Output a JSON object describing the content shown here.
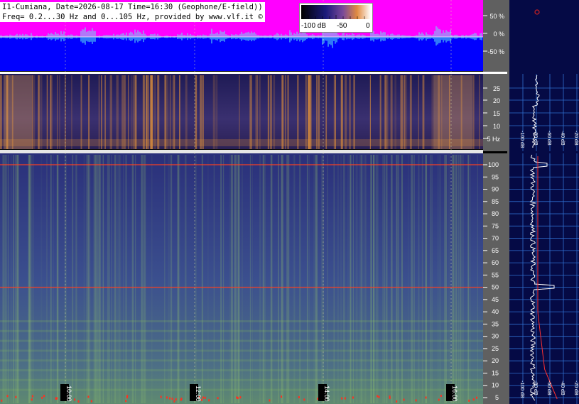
{
  "header": {
    "line1": "I1-Cumiana, Date=2026-08-17 Time=16:30 (Geophone/E-field))",
    "line2": "Freq= 0.2...30 Hz and 0...105 Hz, provided by www.vlf.it ©"
  },
  "colorbar": {
    "label_min": "-100 dB",
    "label_mid": "-50",
    "label_max": "0"
  },
  "time_labels": [
    "10:00",
    "12:00",
    "14:00",
    "16:00"
  ],
  "colors": {
    "magenta": "#ff00ff",
    "blue": "#0000ff",
    "panel_bg": "#050a45",
    "grid_cyan": "#3aa0ff",
    "hum_red": "#ff2020"
  },
  "chart_data": [
    {
      "type": "line",
      "panel": "amplitude",
      "ylabel_ticks": [
        "50 %",
        "0 %",
        "-50 %"
      ],
      "ylim": [
        -100,
        100
      ],
      "series": [
        {
          "values": [
            5,
            8,
            3,
            12,
            6,
            20,
            4,
            9,
            15,
            7,
            3,
            10,
            5,
            18,
            6,
            11,
            4,
            8,
            14,
            6,
            30,
            9,
            5,
            12,
            7,
            4,
            10,
            22,
            6,
            8
          ]
        }
      ]
    },
    {
      "type": "heatmap",
      "panel": "spectrogram-low",
      "y_ticks": [
        "25",
        "20",
        "15",
        "10",
        "5 Hz"
      ],
      "ylim": [
        0.2,
        30
      ]
    },
    {
      "type": "heatmap",
      "panel": "spectrogram-high",
      "y_ticks": [
        "100",
        "95",
        "90",
        "85",
        "80",
        "75",
        "70",
        "65",
        "60",
        "55",
        "50",
        "45",
        "40",
        "35",
        "30",
        "25",
        "20",
        "15",
        "10",
        "5"
      ],
      "ylim": [
        0,
        105
      ],
      "hum_lines_hz": [
        50,
        100
      ]
    },
    {
      "type": "line",
      "panel": "spectrum-low",
      "x_ticks": [
        "-100 dB",
        "-80 dB",
        "-60 dB",
        "-40 dB",
        "-20 dB"
      ]
    },
    {
      "type": "line",
      "panel": "spectrum-high",
      "x_ticks": [
        "-100 dB",
        "-80 dB",
        "-60 dB",
        "-40 dB",
        "-20 dB"
      ]
    }
  ]
}
